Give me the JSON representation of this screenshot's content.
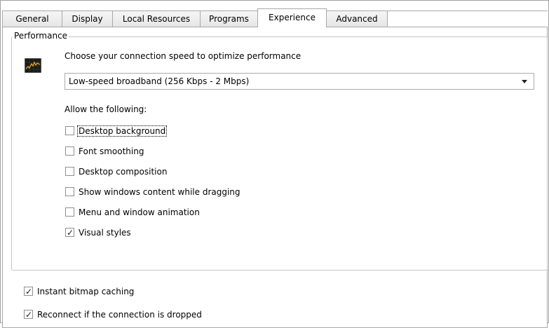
{
  "tabs": [
    {
      "label": "General",
      "active": false
    },
    {
      "label": "Display",
      "active": false
    },
    {
      "label": "Local Resources",
      "active": false
    },
    {
      "label": "Programs",
      "active": false
    },
    {
      "label": "Experience",
      "active": true
    },
    {
      "label": "Advanced",
      "active": false
    }
  ],
  "performance": {
    "group_title": "Performance",
    "icon": "performance-graph-icon",
    "prompt": "Choose your connection speed to optimize performance",
    "speed_select": {
      "value": "Low-speed broadband (256 Kbps - 2 Mbps)"
    },
    "allow_label": "Allow the following:",
    "options": [
      {
        "label": "Desktop background",
        "checked": false,
        "focused": true
      },
      {
        "label": "Font smoothing",
        "checked": false
      },
      {
        "label": "Desktop composition",
        "checked": false
      },
      {
        "label": "Show windows content while dragging",
        "checked": false
      },
      {
        "label": "Menu and window animation",
        "checked": false
      },
      {
        "label": "Visual styles",
        "checked": true
      }
    ]
  },
  "extra_options": [
    {
      "label": "Instant bitmap caching",
      "checked": true
    },
    {
      "label": "Reconnect if the connection is dropped",
      "checked": true
    }
  ],
  "colors": {
    "border": "#a8a8a8",
    "group_border": "#c4c4c4",
    "checkbox_border": "#8e8f8f"
  }
}
